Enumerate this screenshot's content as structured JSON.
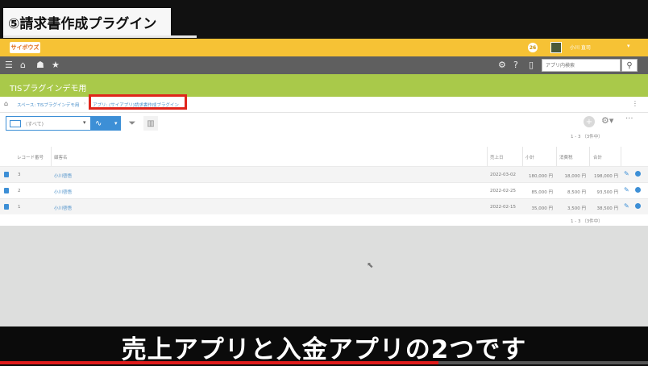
{
  "chapter_title": "⑤請求書作成プラグイン",
  "header": {
    "logo_text": "サイボウズ",
    "user_name": "小川 直司",
    "badge": "26"
  },
  "nav": {
    "search_placeholder": "アプリ内検索"
  },
  "app_title": "TISプラグインデモ用",
  "breadcrumb": {
    "space": "スペース: TISプラグインデモ用",
    "app": "アプリ: (サイアプリ)請求書作成プラグイン"
  },
  "toolbar": {
    "view_label": "(すべて)",
    "pager_top": "1 - 3 （3件中）",
    "pager_bottom": "1 - 3 （3件中）"
  },
  "table": {
    "headers": [
      "レコード番号",
      "顧客名",
      "売上日",
      "小計",
      "消費税",
      "合計"
    ],
    "rows": [
      {
        "id": "3",
        "customer": "小川啓悟",
        "date": "2022-03-02",
        "subtotal": "180,000 円",
        "tax": "18,000 円",
        "total": "198,000 円"
      },
      {
        "id": "2",
        "customer": "小川啓悟",
        "date": "2022-02-25",
        "subtotal": "85,000 円",
        "tax": "8,500 円",
        "total": "93,500 円"
      },
      {
        "id": "1",
        "customer": "小川啓悟",
        "date": "2022-02-15",
        "subtotal": "35,000 円",
        "tax": "3,500 円",
        "total": "38,500 円"
      }
    ]
  },
  "subtitle": "売上アプリと入金アプリの2つです",
  "video_progress": 0.677,
  "colors": {
    "header": "#f6c235",
    "navbar": "#5f5f5f",
    "banner": "#a9c94a",
    "accent": "#3d8fd6",
    "highlight": "#e0251b"
  }
}
